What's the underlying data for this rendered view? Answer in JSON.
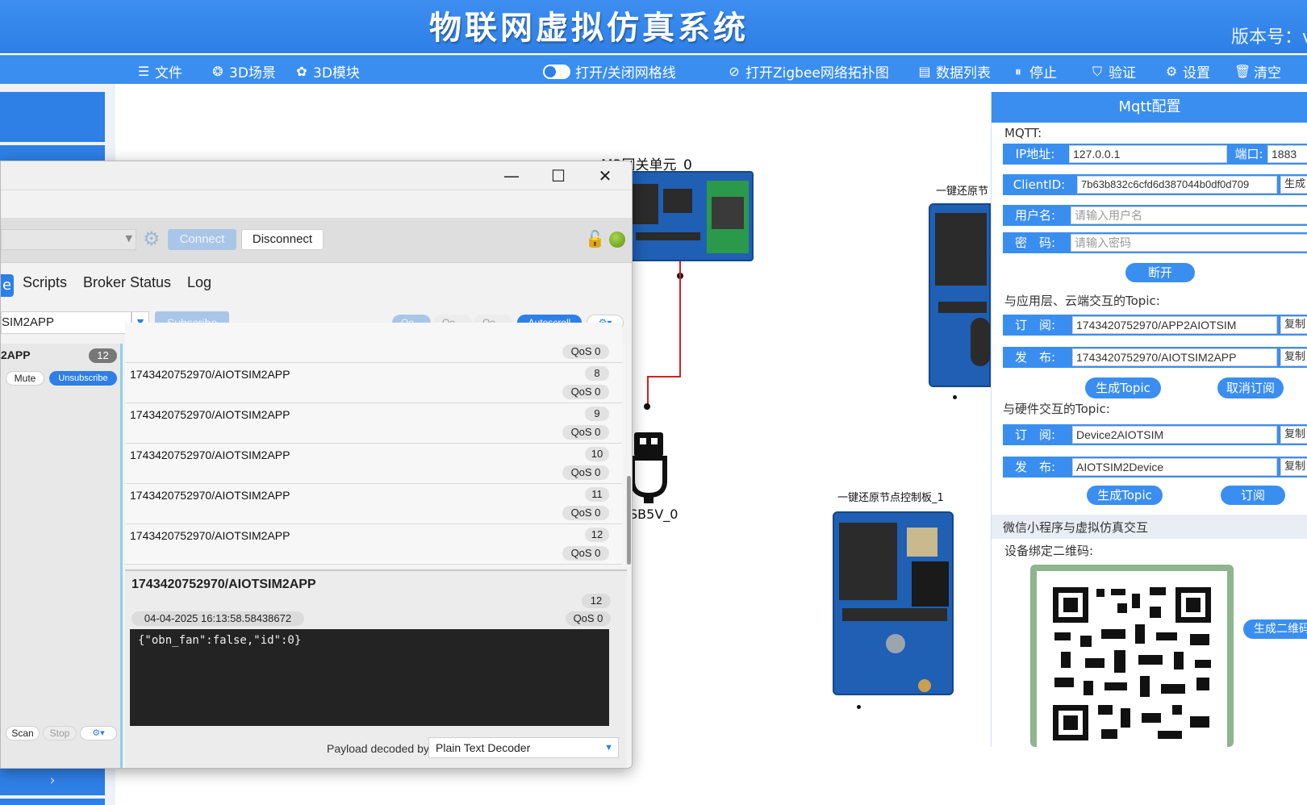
{
  "header": {
    "title": "物联网虚拟仿真系统",
    "version_label": "版本号：v"
  },
  "menu": {
    "file": "文件",
    "scene3d": "3D场景",
    "module3d": "3D模块",
    "grid_toggle": "打开/关闭网格线",
    "zigbee": "打开Zigbee网络拓扑图",
    "data_list": "数据列表",
    "stop": "停止",
    "verify": "验证",
    "settings": "设置",
    "clear": "清空"
  },
  "canvas": {
    "gateway_label": "M3网关单元_0",
    "usb_label": "SB5V_0",
    "restore_board_1": "一键还原节点控制板_1",
    "restore_board_top": "一键还原节"
  },
  "mqtt_client": {
    "connect": "Connect",
    "disconnect": "Disconnect",
    "tabs": [
      "e",
      "Scripts",
      "Broker Status",
      "Log"
    ],
    "subscribe_topic": "SIM2APP",
    "subscribe_btn": "Subscribe",
    "qos_pills": [
      "Qo...",
      "Qo...",
      "Qo..."
    ],
    "autoscroll": "Autoscroll",
    "topic_item": {
      "name": "2APP",
      "count": "12"
    },
    "mute": "Mute",
    "unsubscribe": "Unsubscribe",
    "scan": "Scan",
    "stop": "Stop",
    "messages": [
      {
        "topic": "",
        "num": "",
        "qos": "QoS 0"
      },
      {
        "topic": "1743420752970/AIOTSIM2APP",
        "num": "8",
        "qos": "QoS 0"
      },
      {
        "topic": "1743420752970/AIOTSIM2APP",
        "num": "9",
        "qos": "QoS 0"
      },
      {
        "topic": "1743420752970/AIOTSIM2APP",
        "num": "10",
        "qos": "QoS 0"
      },
      {
        "topic": "1743420752970/AIOTSIM2APP",
        "num": "11",
        "qos": "QoS 0"
      },
      {
        "topic": "1743420752970/AIOTSIM2APP",
        "num": "12",
        "qos": "QoS 0"
      }
    ],
    "detail": {
      "topic": "1743420752970/AIOTSIM2APP",
      "num": "12",
      "timestamp": "04-04-2025  16:13:58.58438672",
      "qos": "QoS 0",
      "payload": "{\"obn_fan\":false,\"id\":0}"
    },
    "decoder_label": "Payload decoded by",
    "decoder_value": "Plain Text Decoder"
  },
  "mqtt_config": {
    "title": "Mqtt配置",
    "section_mqtt": "MQTT:",
    "ip_label": "IP地址:",
    "ip_value": "127.0.0.1",
    "port_label": "端口:",
    "port_value": "1883",
    "clientid_label": "ClientID:",
    "clientid_value": "7b63b832c6cfd6d387044b0df0d709",
    "gen_btn": "生成",
    "user_label": "用户名:",
    "user_placeholder": "请输入用户名",
    "pwd_label": "密　码:",
    "pwd_placeholder": "请输入密码",
    "disconnect_btn": "断开",
    "cloud_section": "与应用层、云端交互的Topic:",
    "sub_label": "订　阅:",
    "cloud_sub_value": "1743420752970/APP2AIOTSIM",
    "pub_label": "发　布:",
    "cloud_pub_value": "1743420752970/AIOTSIM2APP",
    "copy_btn": "复制",
    "gen_topic_btn": "生成Topic",
    "unsub_btn": "取消订阅",
    "hw_section": "与硬件交互的Topic:",
    "hw_sub_value": "Device2AIOTSIM",
    "hw_pub_value": "AIOTSIM2Device",
    "subscribe_btn": "订阅",
    "wechat_section": "微信小程序与虚拟仿真交互",
    "qr_label": "设备绑定二维码:",
    "gen_qr_btn": "生成二维码"
  }
}
